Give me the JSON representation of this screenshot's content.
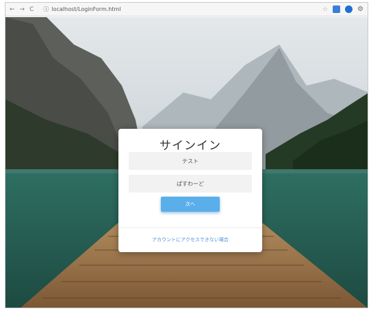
{
  "browser": {
    "nav_back": "←",
    "nav_forward": "→",
    "nav_reload": "C",
    "url": "localhost/LoginForm.html",
    "bookmark_glyph": "☆",
    "settings_glyph": "⚙"
  },
  "login": {
    "title": "サインイン",
    "username_placeholder": "テスト",
    "password_placeholder": "ぱすわーど",
    "submit_label": "次へ",
    "help_link": "アカウントにアクセスできない場合"
  },
  "colors": {
    "accent": "#5aaeea",
    "link": "#4a8fd6",
    "card": "#ffffff"
  }
}
